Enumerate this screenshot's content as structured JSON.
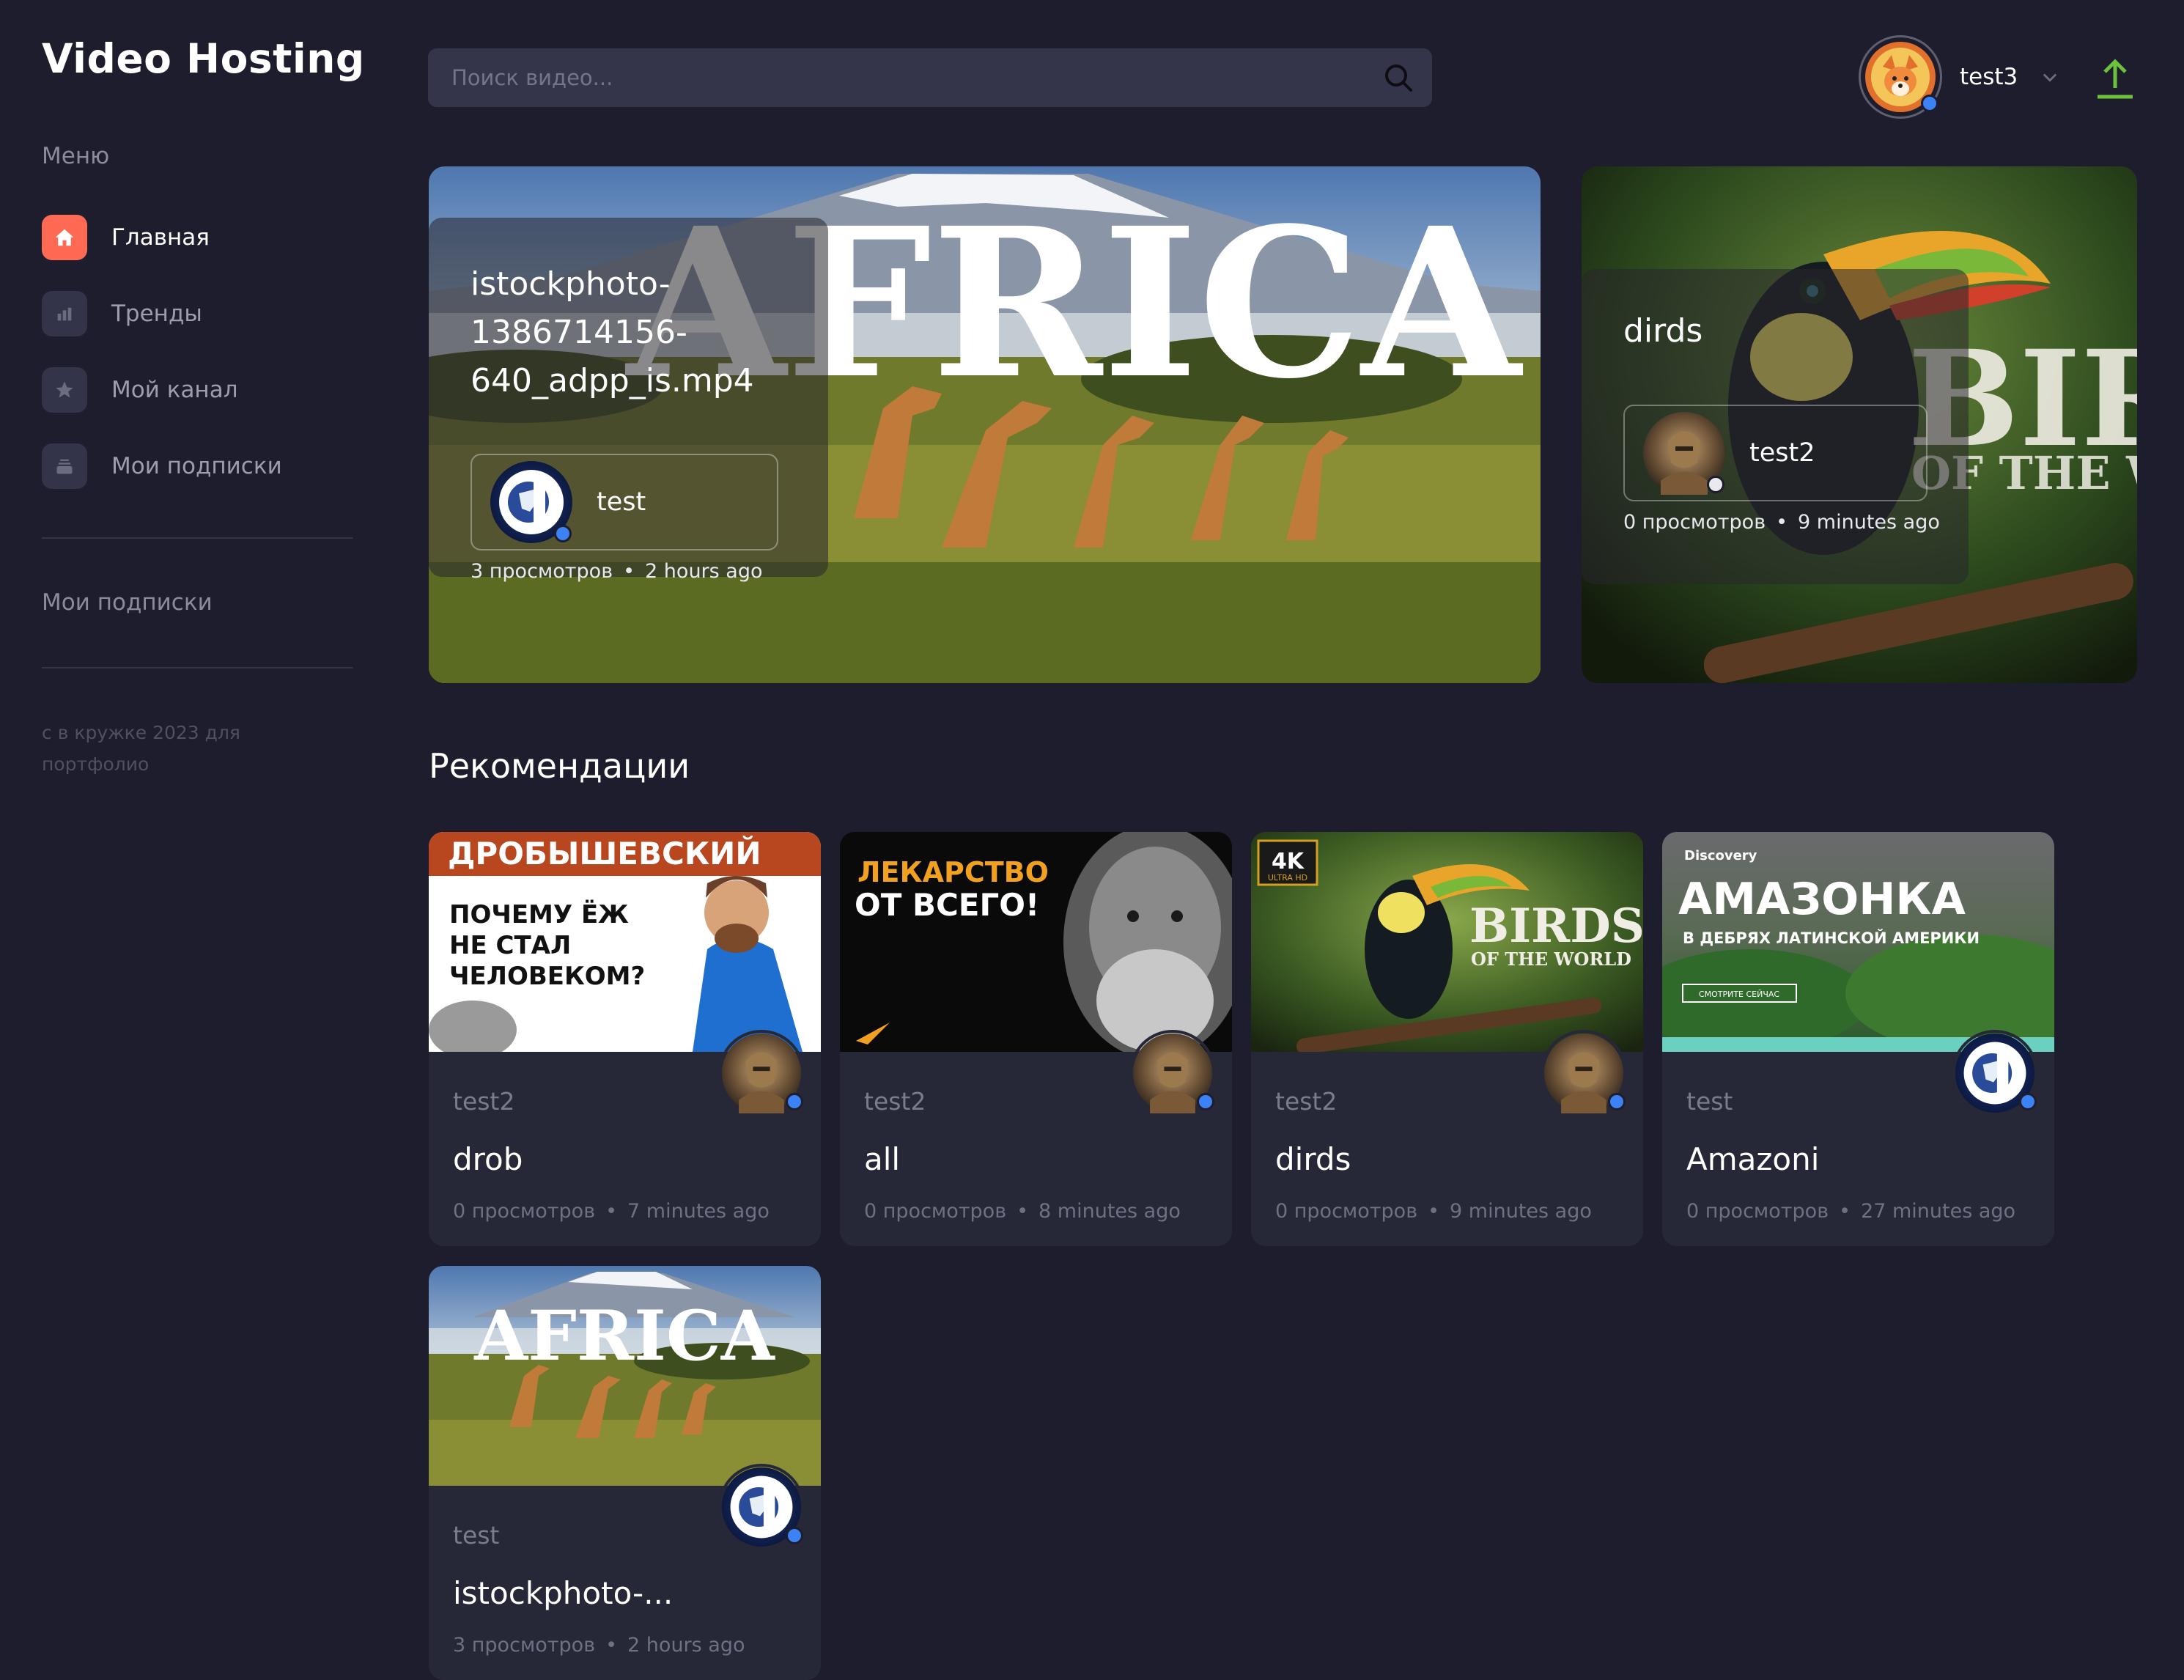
{
  "app": {
    "title": "Video Hosting"
  },
  "sidebar": {
    "menu_heading": "Меню",
    "items": [
      {
        "label": "Главная",
        "icon": "home-icon",
        "active": true
      },
      {
        "label": "Тренды",
        "icon": "chart-icon",
        "active": false
      },
      {
        "label": "Мой канал",
        "icon": "star-icon",
        "active": false
      },
      {
        "label": "Мои подписки",
        "icon": "subscriptions-icon",
        "active": false
      }
    ],
    "subscriptions_heading": "Мои подписки",
    "footer": "с в кружке 2023 для портфолио"
  },
  "header": {
    "search_placeholder": "Поиск видео...",
    "user_name": "test3"
  },
  "hero": [
    {
      "title": "istockphoto-1386714156-640_adpp_is.mp4",
      "author": "test",
      "views": "3 просмотров",
      "time": "2 hours ago",
      "thumb_text": "AFRICA"
    },
    {
      "title": "dirds",
      "author": "test2",
      "views": "0 просмотров",
      "time": "9 minutes ago",
      "thumb_text_1": "BIR",
      "thumb_text_2": "OF THE W"
    }
  ],
  "recommendations": {
    "heading": "Рекомендации",
    "thumb_text": {
      "drob_banner": "ДРОБЫШЕВСКИЙ",
      "drob_q1": "ПОЧЕМУ ЁЖ",
      "drob_q2": "НЕ СТАЛ",
      "drob_q3": "ЧЕЛОВЕКОМ?",
      "all_1": "ЛЕКАРСТВО",
      "all_2": "ОТ ВСЕГО!",
      "birds_4k": "4K",
      "birds_uhd": "ULTRA HD",
      "birds_1": "BIRDS",
      "birds_2": "OF THE WORLD",
      "amaz_brand": "Discovery",
      "amaz_1": "АМАЗОНКА",
      "amaz_2": "В ДЕБРЯХ ЛАТИНСКОЙ АМЕРИКИ",
      "amaz_btn": "СМОТРИТЕ СЕЙЧАС",
      "africa": "AFRICA"
    },
    "cards": [
      {
        "channel": "test2",
        "title": "drob",
        "views": "0 просмотров",
        "time": "7 minutes ago"
      },
      {
        "channel": "test2",
        "title": "all",
        "views": "0 просмотров",
        "time": "8 minutes ago"
      },
      {
        "channel": "test2",
        "title": "dirds",
        "views": "0 просмотров",
        "time": "9 minutes ago"
      },
      {
        "channel": "test",
        "title": "Amazoni",
        "views": "0 просмотров",
        "time": "27 minutes ago"
      },
      {
        "channel": "test",
        "title": "istockphoto-...",
        "views": "3 просмотров",
        "time": "2 hours ago"
      }
    ]
  },
  "colors": {
    "background": "#1e1d2d",
    "accent": "#ff6a55",
    "upload": "#6cc23a",
    "verified": "#3b82f6",
    "card": "#262838"
  }
}
